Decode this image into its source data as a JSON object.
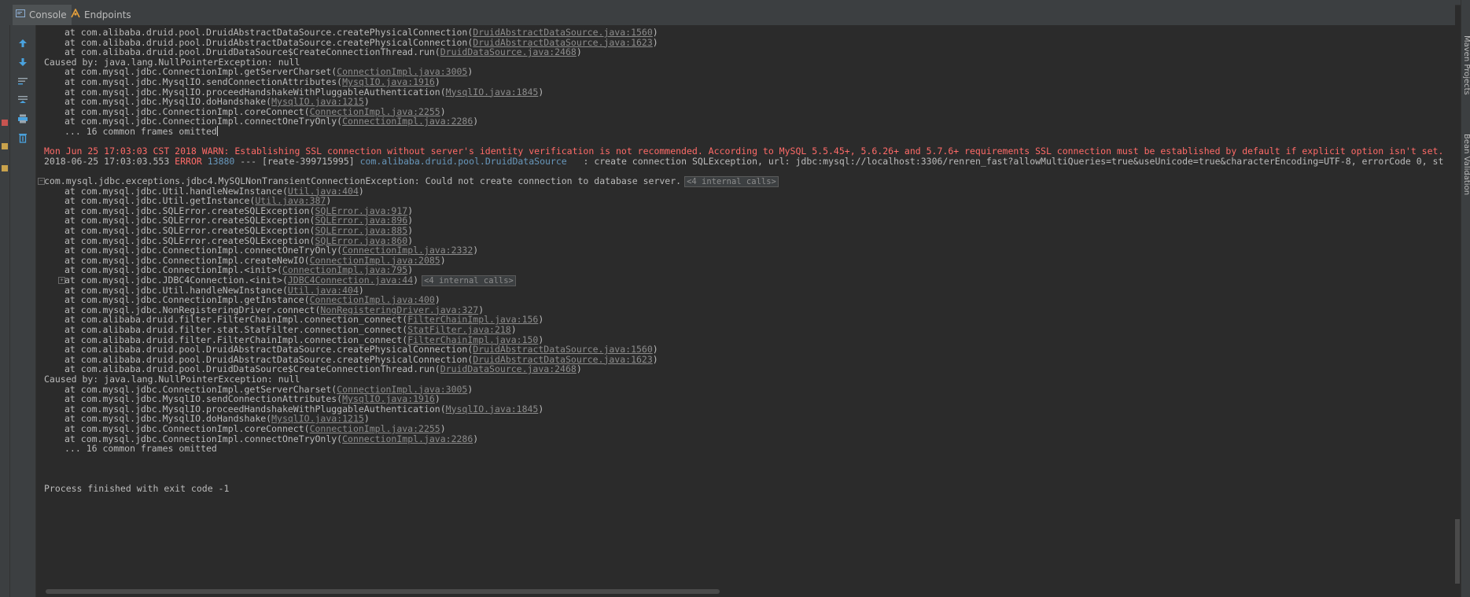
{
  "tabs": [
    {
      "label": "Console",
      "icon": "console-icon"
    },
    {
      "label": "Endpoints",
      "icon": "endpoints-icon"
    }
  ],
  "right_panel": {
    "maven": "Maven Projects",
    "bean": "Bean Validation"
  },
  "console": {
    "block1": [
      {
        "text": "at com.alibaba.druid.pool.DruidAbstractDataSource.createPhysicalConnection(",
        "link": "DruidAbstractDataSource.java:1560",
        "tail": ")"
      },
      {
        "text": "at com.alibaba.druid.pool.DruidAbstractDataSource.createPhysicalConnection(",
        "link": "DruidAbstractDataSource.java:1623",
        "tail": ")"
      },
      {
        "text": "at com.alibaba.druid.pool.DruidDataSource$CreateConnectionThread.run(",
        "link": "DruidDataSource.java:2468",
        "tail": ")"
      }
    ],
    "caused1": "Caused by: java.lang.NullPointerException: null",
    "block2": [
      {
        "text": "at com.mysql.jdbc.ConnectionImpl.getServerCharset(",
        "link": "ConnectionImpl.java:3005",
        "tail": ")"
      },
      {
        "text": "at com.mysql.jdbc.MysqlIO.sendConnectionAttributes(",
        "link": "MysqlIO.java:1916",
        "tail": ")"
      },
      {
        "text": "at com.mysql.jdbc.MysqlIO.proceedHandshakeWithPluggableAuthentication(",
        "link": "MysqlIO.java:1845",
        "tail": ")"
      },
      {
        "text": "at com.mysql.jdbc.MysqlIO.doHandshake(",
        "link": "MysqlIO.java:1215",
        "tail": ")"
      },
      {
        "text": "at com.mysql.jdbc.ConnectionImpl.coreConnect(",
        "link": "ConnectionImpl.java:2255",
        "tail": ")"
      },
      {
        "text": "at com.mysql.jdbc.ConnectionImpl.connectOneTryOnly(",
        "link": "ConnectionImpl.java:2286",
        "tail": ")"
      }
    ],
    "omitted1": "... 16 common frames omitted",
    "warn": "Mon Jun 25 17:03:03 CST 2018 WARN: Establishing SSL connection without server's identity verification is not recommended. According to MySQL 5.5.45+, 5.6.26+ and 5.7.6+ requirements SSL connection must be established by default if explicit option isn't set.",
    "error_line": {
      "timestamp": "2018-06-25 17:03:03.553 ",
      "level": "ERROR",
      "pid": " 13880",
      "thread": " --- [reate-399715995] ",
      "logger": "com.alibaba.druid.pool.DruidDataSource",
      "message": "   : create connection SQLException, url: jdbc:mysql://localhost:3306/renren_fast?allowMultiQueries=true&useUnicode=true&characterEncoding=UTF-8, errorCode 0, st"
    },
    "exception": "com.mysql.jdbc.exceptions.jdbc4.MySQLNonTransientConnectionException: Could not create connection to database server.",
    "internal_calls": "<4 internal calls>",
    "block3": [
      {
        "text": "at com.mysql.jdbc.Util.handleNewInstance(",
        "link": "Util.java:404",
        "tail": ")"
      },
      {
        "text": "at com.mysql.jdbc.Util.getInstance(",
        "link": "Util.java:387",
        "tail": ")"
      },
      {
        "text": "at com.mysql.jdbc.SQLError.createSQLException(",
        "link": "SQLError.java:917",
        "tail": ")"
      },
      {
        "text": "at com.mysql.jdbc.SQLError.createSQLException(",
        "link": "SQLError.java:896",
        "tail": ")"
      },
      {
        "text": "at com.mysql.jdbc.SQLError.createSQLException(",
        "link": "SQLError.java:885",
        "tail": ")"
      },
      {
        "text": "at com.mysql.jdbc.SQLError.createSQLException(",
        "link": "SQLError.java:860",
        "tail": ")"
      },
      {
        "text": "at com.mysql.jdbc.ConnectionImpl.connectOneTryOnly(",
        "link": "ConnectionImpl.java:2332",
        "tail": ")"
      },
      {
        "text": "at com.mysql.jdbc.ConnectionImpl.createNewIO(",
        "link": "ConnectionImpl.java:2085",
        "tail": ")"
      },
      {
        "text": "at com.mysql.jdbc.ConnectionImpl.<init>(",
        "link": "ConnectionImpl.java:795",
        "tail": ")"
      },
      {
        "text": "at com.mysql.jdbc.JDBC4Connection.<init>(",
        "link": "JDBC4Connection.java:44",
        "tail": ")",
        "fold": "<4 internal calls>"
      },
      {
        "text": "at com.mysql.jdbc.Util.handleNewInstance(",
        "link": "Util.java:404",
        "tail": ")"
      },
      {
        "text": "at com.mysql.jdbc.ConnectionImpl.getInstance(",
        "link": "ConnectionImpl.java:400",
        "tail": ")"
      },
      {
        "text": "at com.mysql.jdbc.NonRegisteringDriver.connect(",
        "link": "NonRegisteringDriver.java:327",
        "tail": ")"
      },
      {
        "text": "at com.alibaba.druid.filter.FilterChainImpl.connection_connect(",
        "link": "FilterChainImpl.java:156",
        "tail": ")"
      },
      {
        "text": "at com.alibaba.druid.filter.stat.StatFilter.connection_connect(",
        "link": "StatFilter.java:218",
        "tail": ")"
      },
      {
        "text": "at com.alibaba.druid.filter.FilterChainImpl.connection_connect(",
        "link": "FilterChainImpl.java:150",
        "tail": ")"
      },
      {
        "text": "at com.alibaba.druid.pool.DruidAbstractDataSource.createPhysicalConnection(",
        "link": "DruidAbstractDataSource.java:1560",
        "tail": ")"
      },
      {
        "text": "at com.alibaba.druid.pool.DruidAbstractDataSource.createPhysicalConnection(",
        "link": "DruidAbstractDataSource.java:1623",
        "tail": ")"
      },
      {
        "text": "at com.alibaba.druid.pool.DruidDataSource$CreateConnectionThread.run(",
        "link": "DruidDataSource.java:2468",
        "tail": ")"
      }
    ],
    "caused2": "Caused by: java.lang.NullPointerException: null",
    "block4": [
      {
        "text": "at com.mysql.jdbc.ConnectionImpl.getServerCharset(",
        "link": "ConnectionImpl.java:3005",
        "tail": ")"
      },
      {
        "text": "at com.mysql.jdbc.MysqlIO.sendConnectionAttributes(",
        "link": "MysqlIO.java:1916",
        "tail": ")"
      },
      {
        "text": "at com.mysql.jdbc.MysqlIO.proceedHandshakeWithPluggableAuthentication(",
        "link": "MysqlIO.java:1845",
        "tail": ")"
      },
      {
        "text": "at com.mysql.jdbc.MysqlIO.doHandshake(",
        "link": "MysqlIO.java:1215",
        "tail": ")"
      },
      {
        "text": "at com.mysql.jdbc.ConnectionImpl.coreConnect(",
        "link": "ConnectionImpl.java:2255",
        "tail": ")"
      },
      {
        "text": "at com.mysql.jdbc.ConnectionImpl.connectOneTryOnly(",
        "link": "ConnectionImpl.java:2286",
        "tail": ")"
      }
    ],
    "omitted2": "... 16 common frames omitted",
    "process_finished": "Process finished with exit code -1"
  },
  "colors": {
    "background": "#2b2b2b",
    "error": "#ff6b68",
    "logger": "#6897bb",
    "text": "#bbbbbb"
  }
}
